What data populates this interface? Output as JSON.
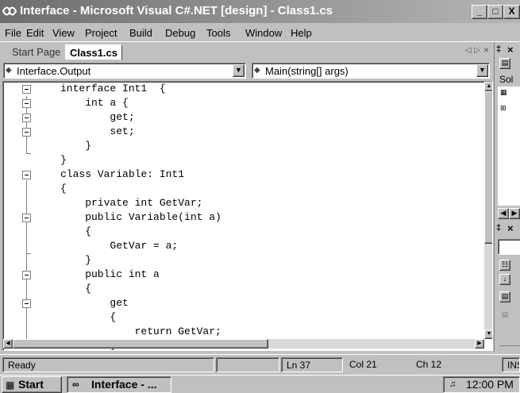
{
  "window": {
    "title": "Interface - Microsoft Visual C#.NET [design] - Class1.cs",
    "caption_buttons": [
      "_",
      "□",
      "X"
    ]
  },
  "menu": {
    "items": [
      "File",
      "Edit",
      "View",
      "Project",
      "Build",
      "Debug",
      "Tools",
      "Window",
      "Help"
    ]
  },
  "tabs": {
    "items": [
      {
        "label": "Start Page",
        "active": false
      },
      {
        "label": "Class1.cs",
        "active": true
      }
    ],
    "nav_glyphs": [
      "◁",
      "▷",
      "×"
    ]
  },
  "combos": {
    "type_selector": "Interface.Output",
    "member_selector": "Main(string[] args)"
  },
  "editor": {
    "lines": [
      "interface Int1  {",
      "    int a {",
      "        get;",
      "        set;",
      "    }",
      "}",
      "class Variable: Int1",
      "{",
      "    private int GetVar;",
      "    public Variable(int a)",
      "    {",
      "        GetVar = a;",
      "    }",
      "    public int a",
      "    {",
      "        get",
      "        {",
      "            return GetVar;",
      "        }"
    ]
  },
  "right_panel": {
    "pin_glyph": "&#x2021;",
    "close_glyph": "×",
    "solution_label": "Sol",
    "props_icons": [
      "categorized-icon",
      "alphabetical-icon",
      "properties-icon"
    ]
  },
  "statusbar": {
    "ready": "Ready",
    "line": "Ln 37",
    "col": "Col 21",
    "ch": "Ch 12",
    "mode": "INS"
  },
  "taskbar": {
    "start_label": "Start",
    "task_label": "Interface - ...",
    "clock": "12:00 PM"
  }
}
